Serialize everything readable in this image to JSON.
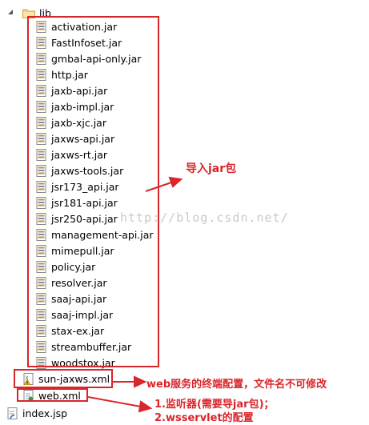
{
  "tree": {
    "folder": {
      "label": "lib",
      "icon": "folder-icon",
      "expanded": true
    },
    "jars": [
      {
        "label": "activation.jar"
      },
      {
        "label": "FastInfoset.jar"
      },
      {
        "label": "gmbal-api-only.jar"
      },
      {
        "label": "http.jar"
      },
      {
        "label": "jaxb-api.jar"
      },
      {
        "label": "jaxb-impl.jar"
      },
      {
        "label": "jaxb-xjc.jar"
      },
      {
        "label": "jaxws-api.jar"
      },
      {
        "label": "jaxws-rt.jar"
      },
      {
        "label": "jaxws-tools.jar"
      },
      {
        "label": "jsr173_api.jar"
      },
      {
        "label": "jsr181-api.jar"
      },
      {
        "label": "jsr250-api.jar"
      },
      {
        "label": "management-api.jar"
      },
      {
        "label": "mimepull.jar"
      },
      {
        "label": "policy.jar"
      },
      {
        "label": "resolver.jar"
      },
      {
        "label": "saaj-api.jar"
      },
      {
        "label": "saaj-impl.jar"
      },
      {
        "label": "stax-ex.jar"
      },
      {
        "label": "streambuffer.jar"
      },
      {
        "label": "woodstox.jar"
      }
    ],
    "files": [
      {
        "label": "sun-jaxws.xml",
        "icon": "xml-warning-icon"
      },
      {
        "label": "web.xml",
        "icon": "xml-file-icon"
      }
    ],
    "root_file": {
      "label": "index.jsp",
      "icon": "jsp-file-icon"
    }
  },
  "annotations": {
    "jar_note": "导入jar包",
    "sunjaxws_note": "web服务的终端配置，文件名不可修改",
    "webxml_note_line1": "1.监听器(需要导jar包)；",
    "webxml_note_line2": "2.wsservlet的配置",
    "color": "#d9262b"
  },
  "watermark": "http://blog.csdn.net/"
}
